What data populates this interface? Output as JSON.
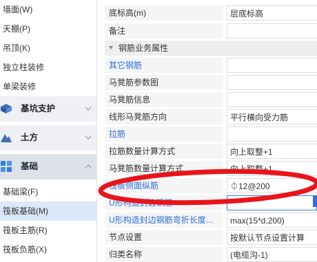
{
  "sidebar": {
    "top_items": [
      {
        "label": "墙面(W)"
      },
      {
        "label": "天棚(P)"
      },
      {
        "label": "吊顶(K)"
      },
      {
        "label": "独立柱装修"
      },
      {
        "label": "单梁装修"
      }
    ],
    "categories": [
      {
        "label": "基坑支护",
        "icon": "foundation-pit-icon"
      },
      {
        "label": "土方",
        "icon": "earthwork-icon"
      },
      {
        "label": "基础",
        "icon": "foundation-icon",
        "expanded": true
      }
    ],
    "foundation_items": [
      {
        "label": "基础梁(F)"
      },
      {
        "label": "筏板基础(M)",
        "selected": true
      },
      {
        "label": "筏板主筋(R)"
      },
      {
        "label": "筏板负筋(X)"
      }
    ]
  },
  "properties": {
    "rows_top": [
      {
        "label": "底标高(m)",
        "value": "层底标高"
      },
      {
        "label": "备注",
        "value": ""
      }
    ],
    "section_title": "钢筋业务属性",
    "rows": [
      {
        "label": "其它钢筋",
        "value": "",
        "link": true
      },
      {
        "label": "马凳筋参数图",
        "value": ""
      },
      {
        "label": "马凳筋信息",
        "value": ""
      },
      {
        "label": "线形马凳筋方向",
        "value": "平行横向受力筋"
      },
      {
        "label": "拉筋",
        "value": "",
        "link": true
      },
      {
        "label": "拉筋数量计算方式",
        "value": "向上取整+1"
      },
      {
        "label": "马凳筋数量计算方式",
        "value": "向上取整+1"
      },
      {
        "label": "筏板侧面纵筋",
        "value": "⏀12@200",
        "link": true
      },
      {
        "label": "U形构造封边钢筋",
        "value": "",
        "link": true,
        "focused": true
      },
      {
        "label": "U形构造封边钢筋弯折长度...",
        "value": "max(15*d,200)",
        "link": true
      },
      {
        "label": "节点设置",
        "value": "按默认节点设置计算"
      },
      {
        "label": "归类名称",
        "value": "(电缆沟-1)"
      }
    ]
  },
  "colors": {
    "link": "#2b6fd6",
    "annotation_ellipse": "#e8141a",
    "selection": "#dbe8f8"
  }
}
